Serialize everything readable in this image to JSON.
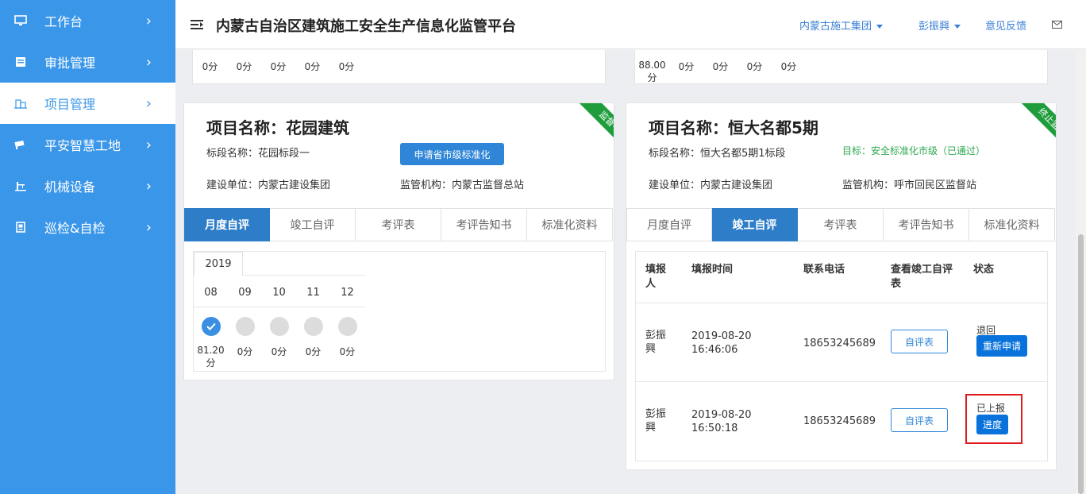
{
  "sidebar": {
    "items": [
      {
        "label": "工作台"
      },
      {
        "label": "审批管理"
      },
      {
        "label": "项目管理"
      },
      {
        "label": "平安智慧工地"
      },
      {
        "label": "机械设备"
      },
      {
        "label": "巡检&自检"
      }
    ]
  },
  "header": {
    "title": "内蒙古自治区建筑施工安全生产信息化监管平台",
    "org": "内蒙古施工集团",
    "user": "彭振興",
    "feedback": "意见反馈"
  },
  "top_left_scores": [
    "0分",
    "0分",
    "0分",
    "0分",
    "0分"
  ],
  "top_right_scores": [
    "88.00分",
    "0分",
    "0分",
    "0分",
    "0分"
  ],
  "project_left": {
    "ribbon": "监督中",
    "name": "项目名称：花园建筑",
    "section": "标段名称：花园标段一",
    "apply_button": "申请省市级标准化",
    "builder": "建设单位：内蒙古建设集团",
    "supervisor": "监管机构：内蒙古监督总站",
    "tabs": [
      "月度自评",
      "竣工自评",
      "考评表",
      "考评告知书",
      "标准化资料"
    ],
    "year": "2019",
    "months": [
      "08",
      "09",
      "10",
      "11",
      "12"
    ],
    "scores": [
      "81.20分",
      "0分",
      "0分",
      "0分",
      "0分"
    ]
  },
  "project_right": {
    "ribbon": "终止监督",
    "name": "项目名称：恒大名都5期",
    "section": "标段名称：恒大名都5期1标段",
    "target": "目标：安全标准化市级（已通过）",
    "builder": "建设单位：内蒙古建设集团",
    "supervisor": "监管机构：呼市回民区监督站",
    "tabs": [
      "月度自评",
      "竣工自评",
      "考评表",
      "考评告知书",
      "标准化资料"
    ],
    "table": {
      "headers": [
        "填报人",
        "填报时间",
        "联系电话",
        "查看竣工自评表",
        "状态"
      ],
      "rows": [
        {
          "reporter": "彭振興",
          "date": "2019-08-20",
          "time": "16:46:06",
          "phone": "18653245689",
          "view": "自评表",
          "status": "退回",
          "action": "重新申请"
        },
        {
          "reporter": "彭振興",
          "date": "2019-08-20",
          "time": "16:50:18",
          "phone": "18653245689",
          "view": "自评表",
          "status": "已上报",
          "action": "进度"
        }
      ]
    }
  }
}
